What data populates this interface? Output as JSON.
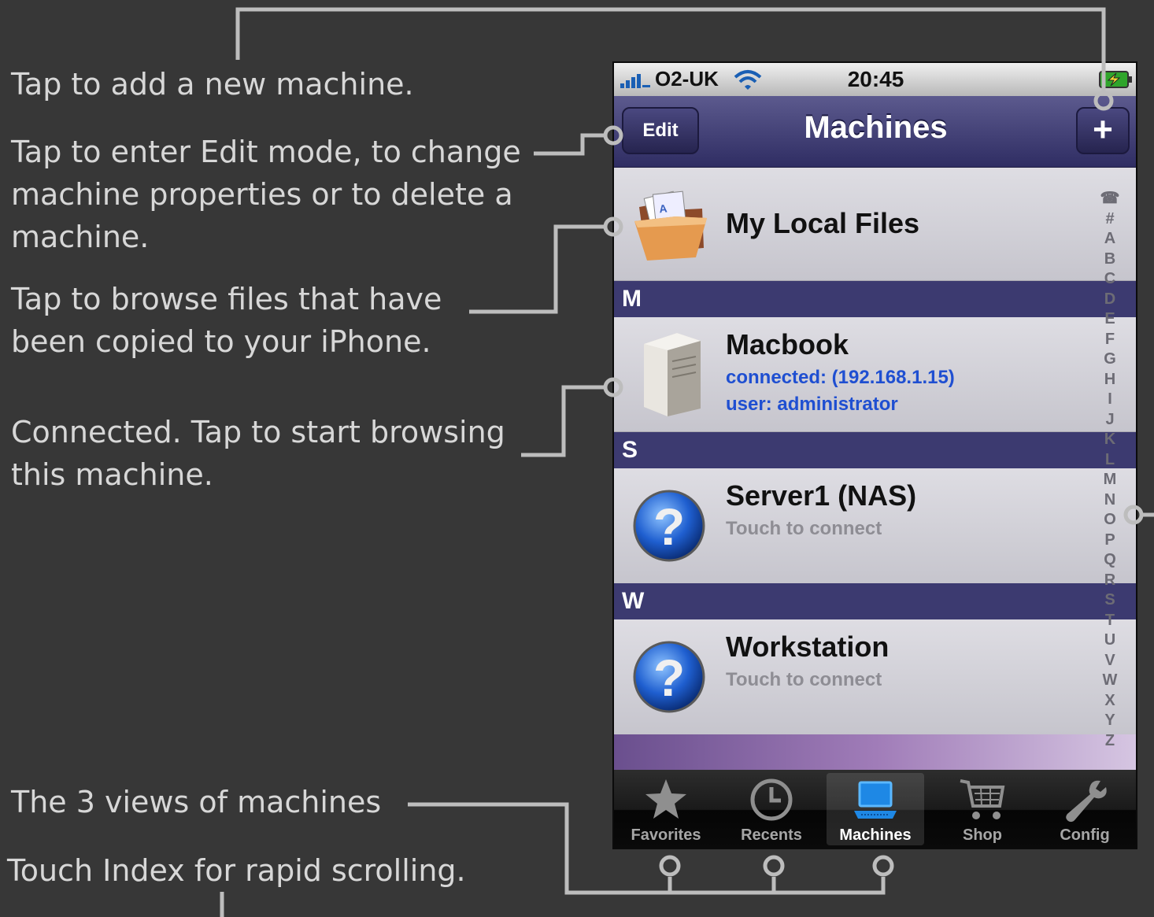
{
  "annotations": {
    "add_machine": "Tap to add a new machine.",
    "edit_mode": [
      "Tap to enter Edit mode, to change",
      "machine properties or to delete a",
      "machine."
    ],
    "local_files": [
      "Tap to browse files that have",
      "been copied to your iPhone."
    ],
    "connected": [
      "Connected. Tap to start browsing",
      "this machine."
    ],
    "views": "The 3 views of machines",
    "index": "Touch Index for rapid scrolling."
  },
  "status_bar": {
    "carrier": "O2-UK",
    "time": "20:45"
  },
  "nav": {
    "title": "Machines",
    "edit_label": "Edit",
    "add_label": "+"
  },
  "local_files": {
    "title": "My Local Files"
  },
  "sections": [
    {
      "letter": "M",
      "items": [
        {
          "name": "Macbook",
          "status": "connected: (192.168.1.15)",
          "user": "user: administrator"
        }
      ]
    },
    {
      "letter": "S",
      "items": [
        {
          "name": "Server1 (NAS)",
          "status": "Touch to connect"
        }
      ]
    },
    {
      "letter": "W",
      "items": [
        {
          "name": "Workstation",
          "status": "Touch to connect"
        }
      ]
    }
  ],
  "index_letters": [
    "☎",
    "#",
    "A",
    "B",
    "C",
    "D",
    "E",
    "F",
    "G",
    "H",
    "I",
    "J",
    "K",
    "L",
    "M",
    "N",
    "O",
    "P",
    "Q",
    "R",
    "S",
    "T",
    "U",
    "V",
    "W",
    "X",
    "Y",
    "Z"
  ],
  "tabs": [
    {
      "label": "Favorites",
      "icon": "star-icon"
    },
    {
      "label": "Recents",
      "icon": "clock-icon"
    },
    {
      "label": "Machines",
      "icon": "laptop-icon",
      "active": true
    },
    {
      "label": "Shop",
      "icon": "cart-icon"
    },
    {
      "label": "Config",
      "icon": "wrench-icon"
    }
  ],
  "colors": {
    "background": "#373737",
    "annotation_text": "#d7d7d7",
    "nav_bar": "#3c3a70",
    "connected_text": "#1f4fd1",
    "hint_text": "#8e8d94",
    "callout_line": "#bdbdbd"
  }
}
